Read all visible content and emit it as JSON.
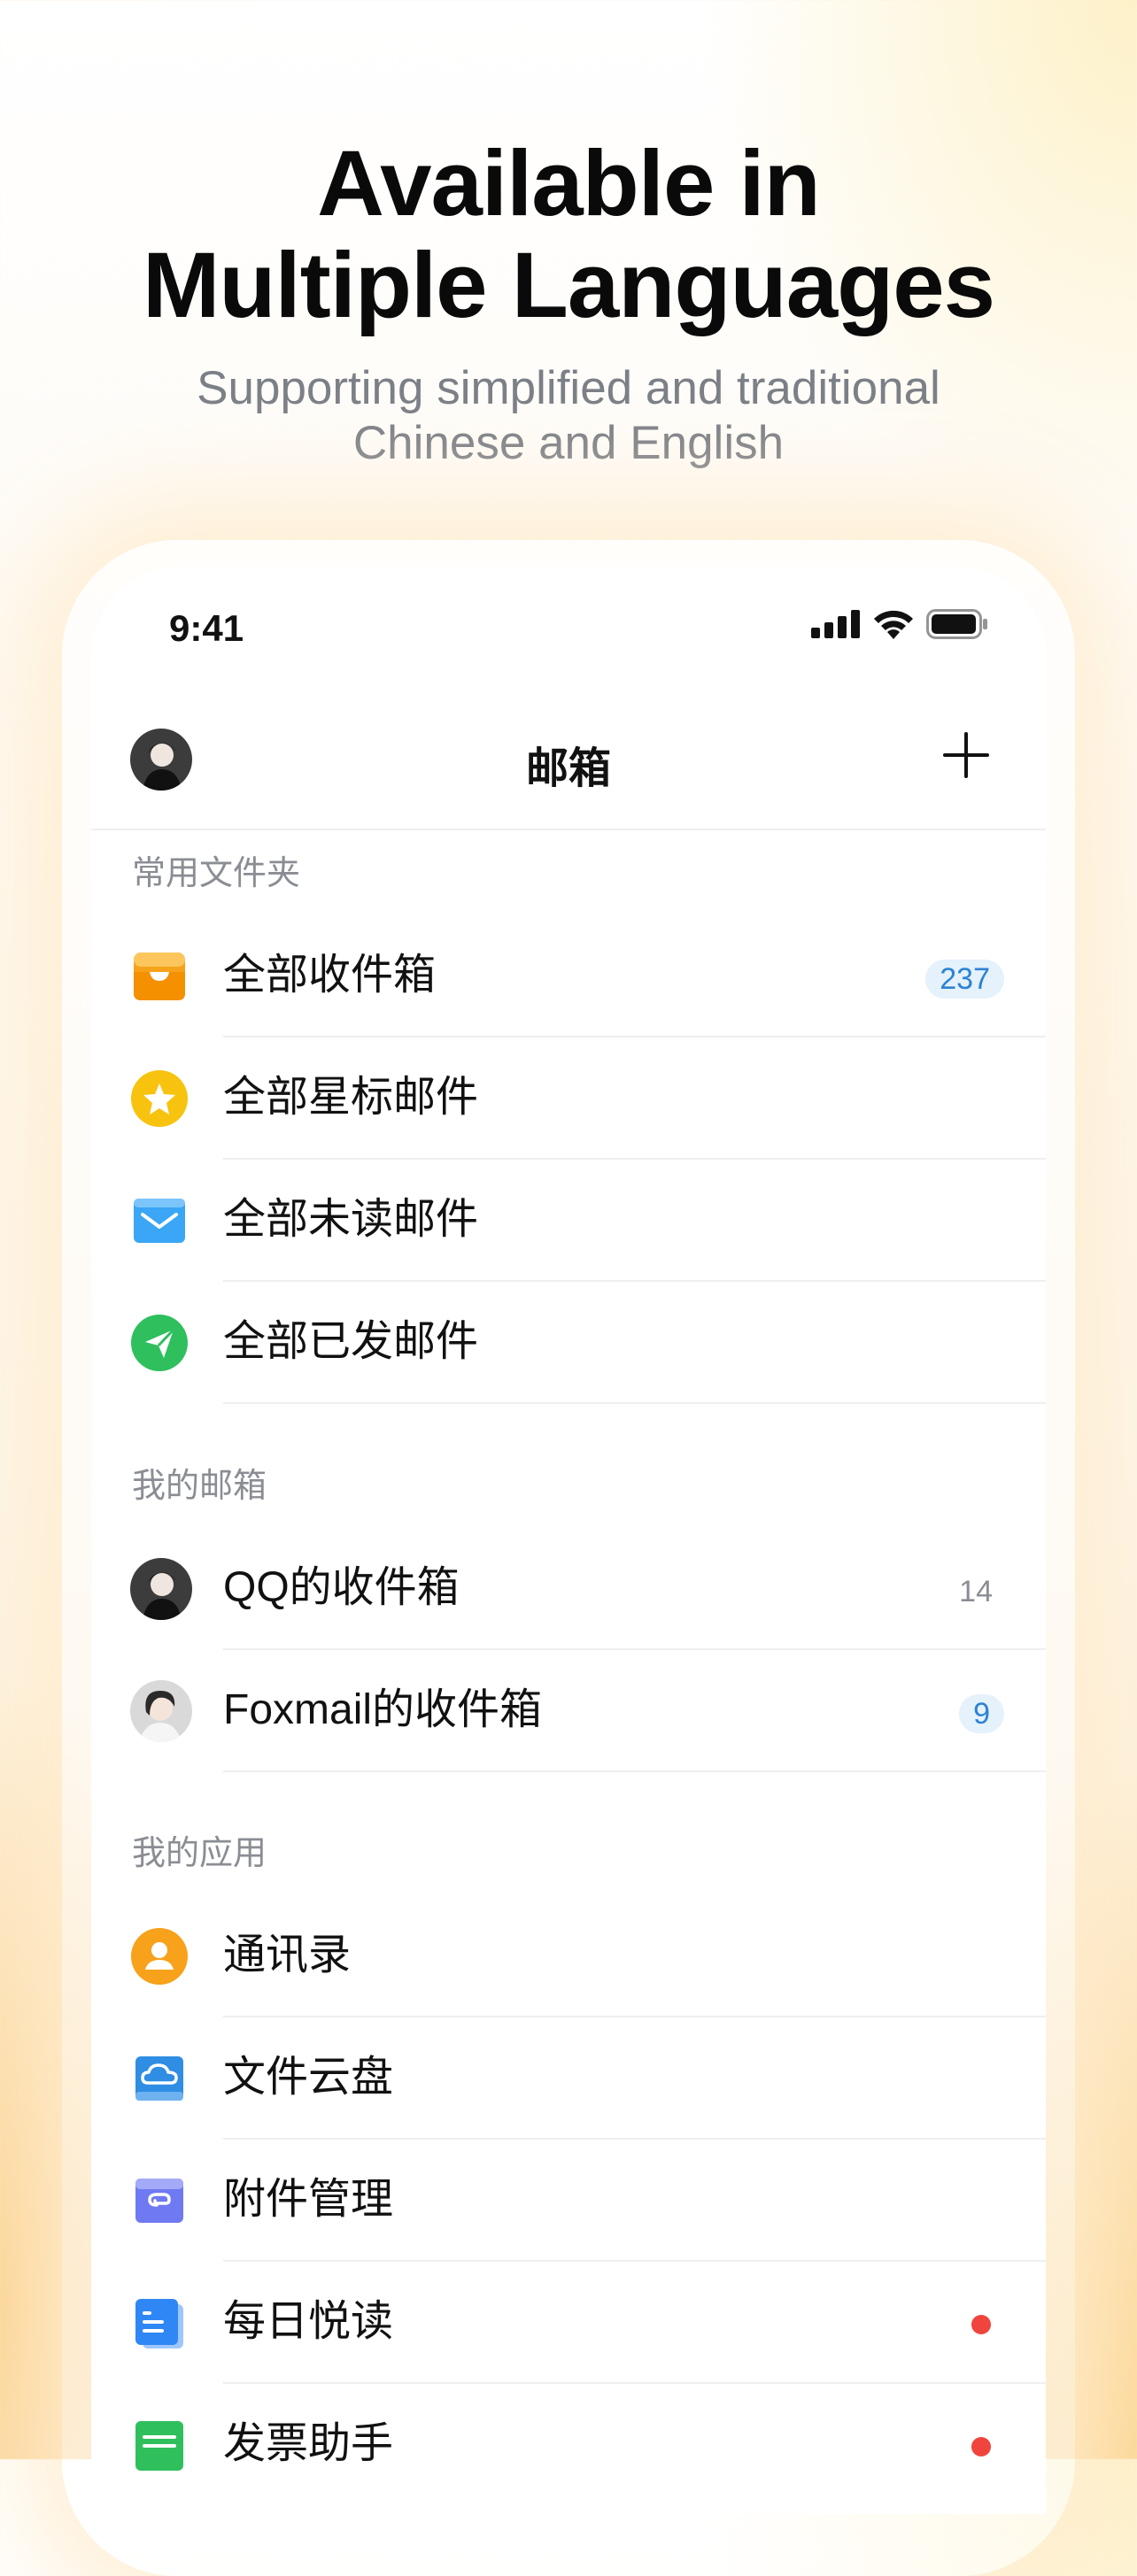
{
  "hero": {
    "title_line1": "Available in",
    "title_line2": "Multiple Languages",
    "subtitle_line1": "Supporting simplified and traditional",
    "subtitle_line2": "Chinese and English"
  },
  "status_bar": {
    "time": "9:41"
  },
  "nav": {
    "title": "邮箱"
  },
  "sections": {
    "common": "常用文件夹",
    "my_mailboxes": "我的邮箱",
    "my_apps": "我的应用"
  },
  "common_folders": [
    {
      "label": "全部收件箱",
      "count": "237",
      "icon": "inbox-icon"
    },
    {
      "label": "全部星标邮件",
      "icon": "star-icon"
    },
    {
      "label": "全部未读邮件",
      "icon": "unread-mail-icon"
    },
    {
      "label": "全部已发邮件",
      "icon": "sent-icon"
    }
  ],
  "mailboxes": [
    {
      "label": "QQ的收件箱",
      "count": "14"
    },
    {
      "label": "Foxmail的收件箱",
      "count": "9"
    }
  ],
  "apps": [
    {
      "label": "通讯录",
      "icon": "contacts-icon"
    },
    {
      "label": "文件云盘",
      "icon": "cloud-drive-icon"
    },
    {
      "label": "附件管理",
      "icon": "attachment-icon"
    },
    {
      "label": "每日悦读",
      "icon": "reading-icon",
      "dot": true
    },
    {
      "label": "发票助手",
      "icon": "invoice-icon",
      "dot": true
    }
  ],
  "colors": {
    "inbox": "#f7a21b",
    "star": "#f8c30f",
    "unread": "#3aa6f5",
    "sent": "#2fbf5d",
    "contacts": "#f8a11b",
    "cloud": "#2f8de3",
    "attachment": "#6f79f2",
    "reading": "#2f86f5",
    "invoice": "#2fbf5d",
    "badge_text": "#2c83d3",
    "dot": "#f0443c"
  }
}
